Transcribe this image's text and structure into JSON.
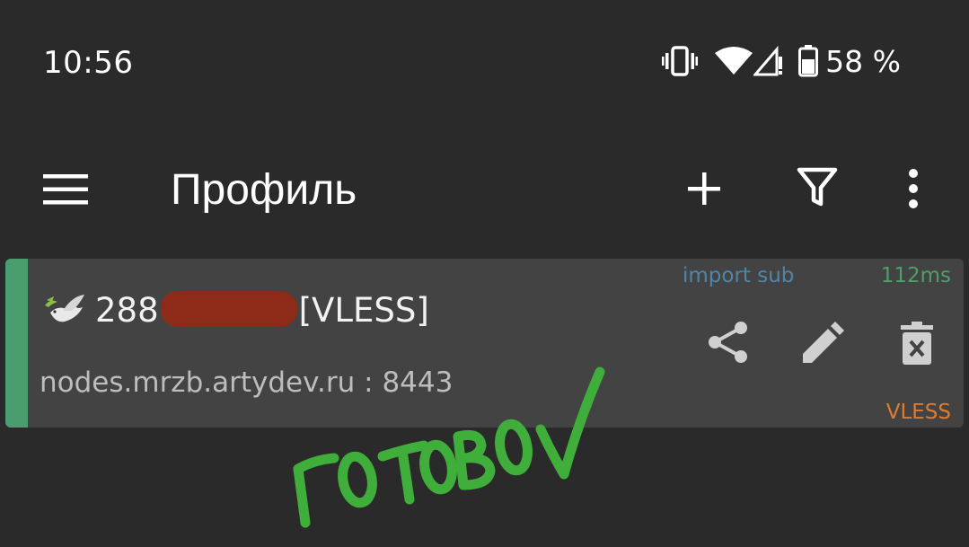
{
  "status_bar": {
    "time": "10:56",
    "battery_percent": "58 %",
    "icons": [
      "vibrate-icon",
      "wifi-icon",
      "cellular-no-signal-icon",
      "battery-icon"
    ]
  },
  "app_bar": {
    "title": "Профиль",
    "actions": [
      "menu-icon",
      "add-icon",
      "filter-icon",
      "more-vert-icon"
    ]
  },
  "server_list": [
    {
      "name_prefix": "288",
      "name_suffix": "[VLESS]",
      "address": "nodes.mrzb.artydev.ru : 8443",
      "subscription": "import sub",
      "latency": "112ms",
      "protocol": "VLESS",
      "selected": true,
      "actions": [
        "share-icon",
        "edit-icon",
        "delete-icon"
      ]
    }
  ],
  "annotation": {
    "handwritten_text": "Готово ✓",
    "color": "#3fae3a"
  },
  "colors": {
    "background": "#2a2a2a",
    "card": "#434343",
    "selected_accent": "#4a9d6e",
    "subscription_text": "#4f86a8",
    "latency_text": "#4f9f69",
    "protocol_text": "#e07a2f",
    "redaction": "#8e2a18"
  }
}
